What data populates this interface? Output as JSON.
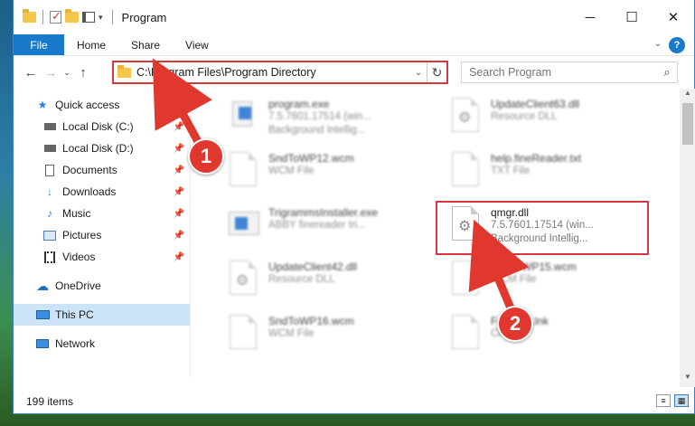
{
  "window": {
    "title": "Program",
    "controls": {
      "minimize": "─",
      "maximize": "☐",
      "close": "✕"
    }
  },
  "ribbon": {
    "file_tab": "File",
    "tabs": [
      "Home",
      "Share",
      "View"
    ],
    "help": "?"
  },
  "nav": {
    "address": "C:\\Program Files\\Program Directory",
    "search_placeholder": "Search Program"
  },
  "sidebar": {
    "items": [
      {
        "label": "Quick access",
        "icon": "star-icon"
      },
      {
        "label": "Local Disk (C:)",
        "icon": "drive-icon"
      },
      {
        "label": "Local Disk (D:)",
        "icon": "drive-icon"
      },
      {
        "label": "Documents",
        "icon": "documents-icon"
      },
      {
        "label": "Downloads",
        "icon": "download-icon"
      },
      {
        "label": "Music",
        "icon": "music-icon"
      },
      {
        "label": "Pictures",
        "icon": "pictures-icon"
      },
      {
        "label": "Videos",
        "icon": "videos-icon"
      },
      {
        "label": "OneDrive",
        "icon": "cloud-icon"
      },
      {
        "label": "This PC",
        "icon": "computer-icon"
      },
      {
        "label": "Network",
        "icon": "network-icon"
      }
    ]
  },
  "files": [
    {
      "name": "program.exe",
      "l1": "7.5.7601.17514 (win...",
      "l2": "Background Intellig..."
    },
    {
      "name": "UpdateClient63.dll",
      "l1": "Resource DLL",
      "l2": ""
    },
    {
      "name": "SndToWP12.wcm",
      "l1": "WCM File",
      "l2": ""
    },
    {
      "name": "help.fineReader.txt",
      "l1": "TXT File",
      "l2": ""
    },
    {
      "name": "TrigrammsInstaller.exe",
      "l1": "ABBY finereader tri...",
      "l2": ""
    },
    {
      "name": "qmgr.dll",
      "l1": "7.5.7601.17514 (win...",
      "l2": "Background Intellig..."
    },
    {
      "name": "UpdateClient42.dll",
      "l1": "Resource DLL",
      "l2": ""
    },
    {
      "name": "SndToWP15.wcm",
      "l1": "WCM File",
      "l2": ""
    },
    {
      "name": "SndToWP16.wcm",
      "l1": "WCM File",
      "l2": ""
    },
    {
      "name": "FastLink.lnk",
      "l1": "CK File",
      "l2": ""
    }
  ],
  "status": {
    "items_count": "199 items"
  },
  "annotations": {
    "callout1": "1",
    "callout2": "2",
    "color": "#e0382f"
  }
}
